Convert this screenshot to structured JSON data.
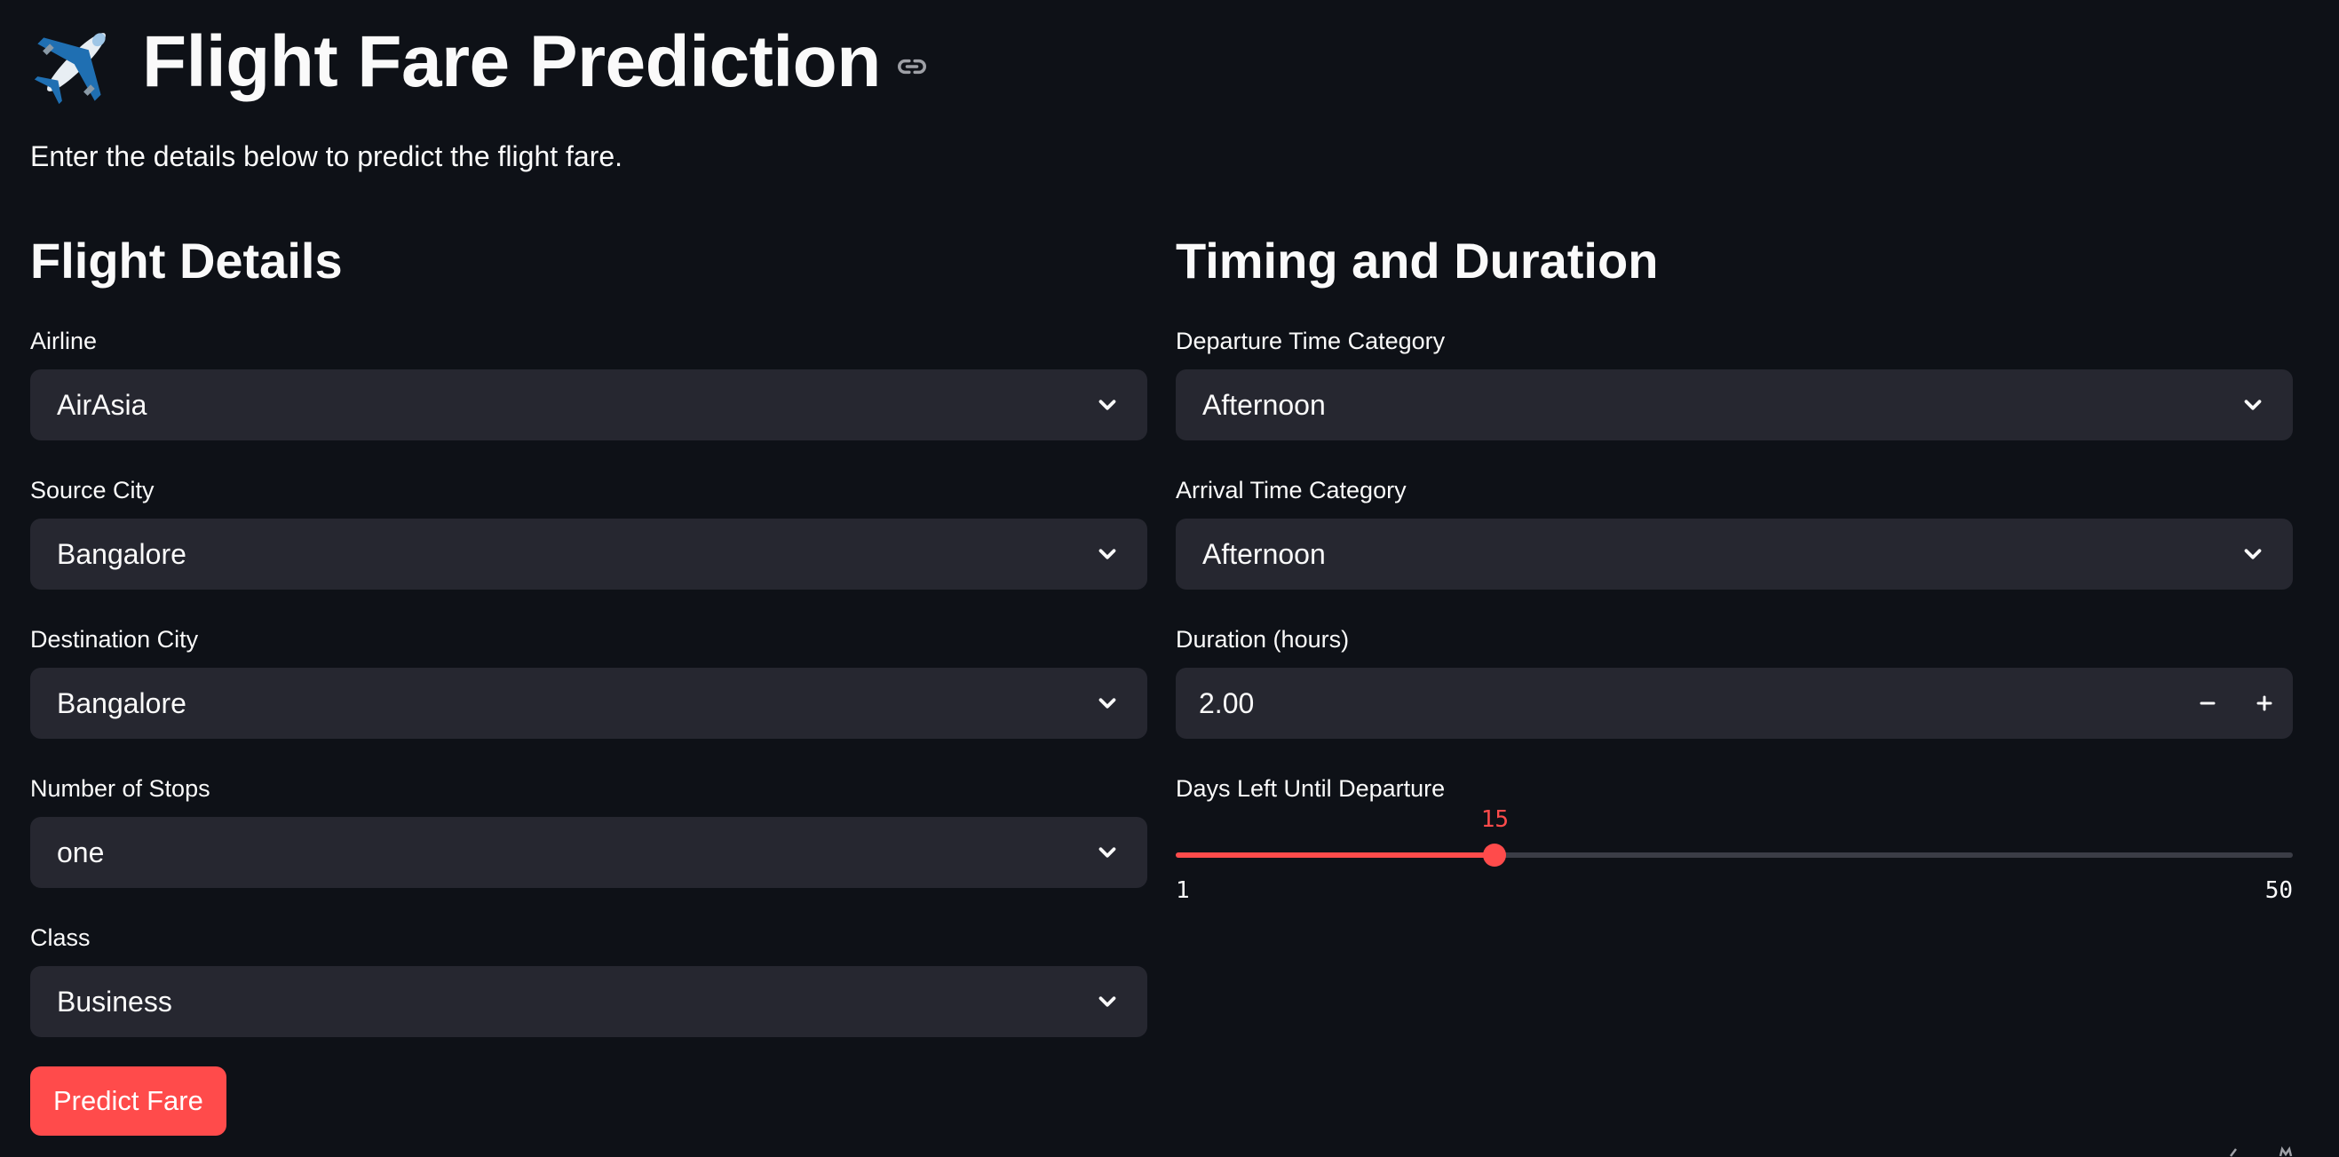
{
  "header": {
    "title": "Flight Fare Prediction",
    "subtitle": "Enter the details below to predict the flight fare."
  },
  "flight_details": {
    "heading": "Flight Details",
    "airline": {
      "label": "Airline",
      "value": "AirAsia"
    },
    "source_city": {
      "label": "Source City",
      "value": "Bangalore"
    },
    "destination_city": {
      "label": "Destination City",
      "value": "Bangalore"
    },
    "stops": {
      "label": "Number of Stops",
      "value": "one"
    },
    "class": {
      "label": "Class",
      "value": "Business"
    }
  },
  "timing": {
    "heading": "Timing and Duration",
    "departure_time": {
      "label": "Departure Time Category",
      "value": "Afternoon"
    },
    "arrival_time": {
      "label": "Arrival Time Category",
      "value": "Afternoon"
    },
    "duration": {
      "label": "Duration (hours)",
      "value": "2.00"
    },
    "days_left": {
      "label": "Days Left Until Departure",
      "value": 15,
      "min": 1,
      "max": 50
    }
  },
  "actions": {
    "predict_label": "Predict Fare"
  },
  "colors": {
    "background": "#0e1117",
    "widget": "#262730",
    "accent": "#ff4b4b",
    "text": "#fafafa"
  },
  "icons": {
    "title_icon": "airplane-icon",
    "anchor_icon": "link-icon",
    "select_icon": "chevron-down-icon",
    "decrement_icon": "minus-icon",
    "increment_icon": "plus-icon"
  }
}
